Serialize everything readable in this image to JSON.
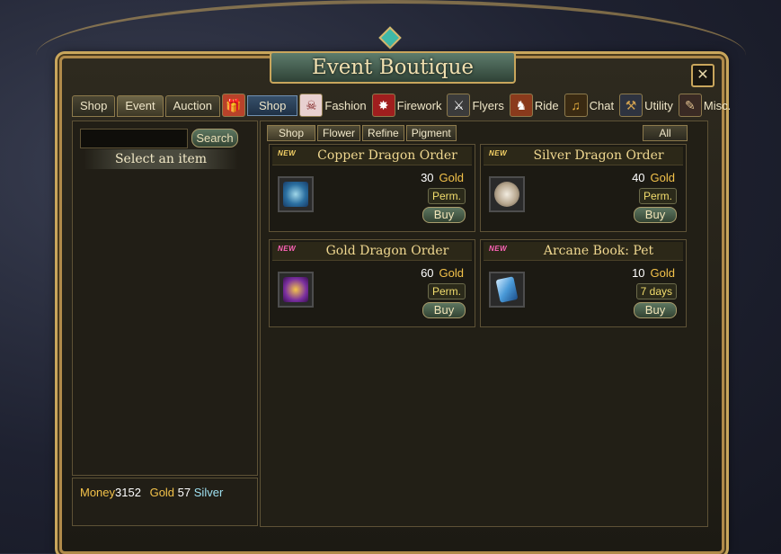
{
  "window": {
    "title": "Event Boutique",
    "close_label": "✕"
  },
  "main_tabs": [
    {
      "label": "Shop"
    },
    {
      "label": "Event"
    },
    {
      "label": "Auction"
    }
  ],
  "category_tabs": [
    {
      "label": "Shop",
      "icon": "gift-icon"
    },
    {
      "label": "Fashion",
      "icon": "skull-costume-icon"
    },
    {
      "label": "Firework",
      "icon": "firework-icon"
    },
    {
      "label": "Flyers",
      "icon": "sword-flyer-icon"
    },
    {
      "label": "Ride",
      "icon": "horse-icon"
    },
    {
      "label": "Chat",
      "icon": "horn-icon"
    },
    {
      "label": "Utility",
      "icon": "tools-icon"
    },
    {
      "label": "Misc.",
      "icon": "scroll-icon"
    }
  ],
  "search": {
    "value": "",
    "button_label": "Search",
    "select_label": "Select an item"
  },
  "money": {
    "prefix": "Money",
    "gold_amount": "3152",
    "gold_label": "Gold",
    "silver_amount": "57",
    "silver_label": "Silver"
  },
  "sub_tabs": [
    {
      "label": "Shop"
    },
    {
      "label": "Flower"
    },
    {
      "label": "Refine"
    },
    {
      "label": "Pigment"
    }
  ],
  "filter_all": "All",
  "items": [
    {
      "tag": "NEW",
      "name": "Copper Dragon Order",
      "price": "30",
      "currency": "Gold",
      "duration": "Perm.",
      "buy_label": "Buy",
      "icon": "copper-dragon-icon"
    },
    {
      "tag": "NEW",
      "name": "Silver Dragon Order",
      "price": "40",
      "currency": "Gold",
      "duration": "Perm.",
      "buy_label": "Buy",
      "icon": "silver-dragon-icon"
    },
    {
      "tag": "NEW",
      "name": "Gold Dragon Order",
      "price": "60",
      "currency": "Gold",
      "duration": "Perm.",
      "buy_label": "Buy",
      "icon": "gold-dragon-icon"
    },
    {
      "tag": "NEW",
      "name": "Arcane Book: Pet",
      "price": "10",
      "currency": "Gold",
      "duration": "7 days",
      "buy_label": "Buy",
      "icon": "book-icon"
    }
  ],
  "colors": {
    "gold_text": "#f3c24a",
    "silver_text": "#9ee0f0",
    "frame": "#c9a65c",
    "new_tag_yellow": "#f4d166",
    "new_tag_pink": "#ff63b8"
  }
}
